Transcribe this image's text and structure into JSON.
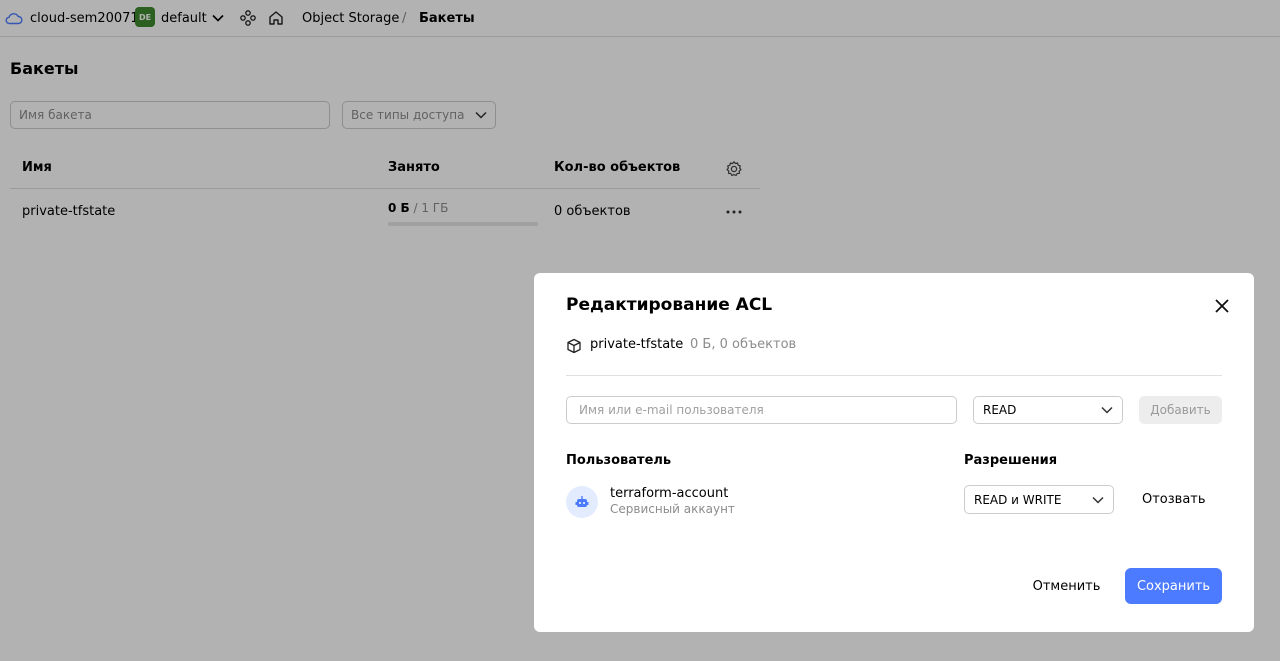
{
  "topbar": {
    "cloud_name": "cloud-sem20071",
    "folder_badge": "DE",
    "folder_name": "default",
    "breadcrumb_service": "Object Storage",
    "breadcrumb_sep": "/",
    "breadcrumb_current": "Бакеты"
  },
  "main": {
    "title": "Бакеты",
    "search_placeholder": "Имя бакета",
    "access_filter": "Все типы доступа",
    "table": {
      "headers": {
        "name": "Имя",
        "used": "Занято",
        "count": "Кол-во объектов"
      },
      "rows": [
        {
          "name": "private-tfstate",
          "used": "0 Б",
          "total": " / 1 ГБ",
          "usage_fraction": 0,
          "count": "0 объектов"
        }
      ]
    }
  },
  "modal": {
    "title": "Редактирование ACL",
    "bucket_name": "private-tfstate",
    "bucket_meta": "0 Б, 0 объектов",
    "user_input_placeholder": "Имя или e-mail пользователя",
    "permission_select": "READ",
    "add_label": "Добавить",
    "col_user": "Пользователь",
    "col_permissions": "Разрешения",
    "entries": [
      {
        "name": "terraform-account",
        "type": "Сервисный аккаунт",
        "permission": "READ и WRITE",
        "revoke_label": "Отозвать"
      }
    ],
    "cancel_label": "Отменить",
    "save_label": "Сохранить"
  },
  "colors": {
    "accent": "#4d7bff",
    "folder_badge": "#3f8a2e",
    "overlay": "rgba(0,0,0,0.30)"
  }
}
